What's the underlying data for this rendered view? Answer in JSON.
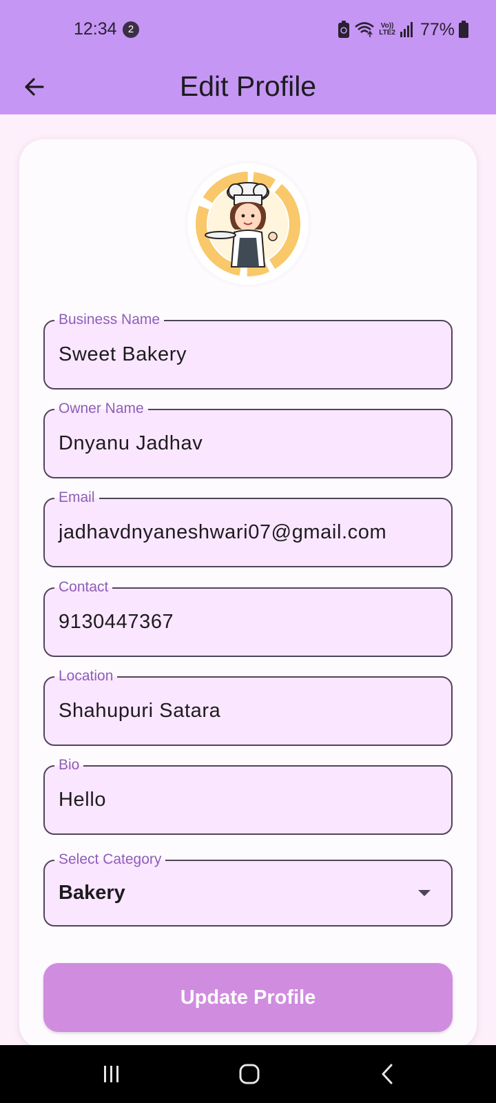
{
  "status_bar": {
    "time": "12:34",
    "notification_count": "2",
    "network_label_top": "Vo))",
    "network_label_bottom": "LTE2",
    "battery_percent": "77%"
  },
  "app_bar": {
    "title": "Edit Profile",
    "back_icon": "arrow-left-icon"
  },
  "avatar": {
    "description_icon": "chef-avatar"
  },
  "form": {
    "fields": [
      {
        "label": "Business Name",
        "value": "Sweet Bakery"
      },
      {
        "label": "Owner Name",
        "value": "Dnyanu Jadhav"
      },
      {
        "label": "Email",
        "value": "jadhavdnyaneshwari07@gmail.com"
      },
      {
        "label": "Contact",
        "value": "9130447367"
      },
      {
        "label": "Location",
        "value": "Shahupuri Satara"
      },
      {
        "label": "Bio",
        "value": "Hello"
      }
    ],
    "category": {
      "label": "Select Category",
      "value": "Bakery"
    },
    "submit_label": "Update Profile"
  },
  "colors": {
    "app_bar": "#c596f3",
    "background": "#fdf0fa",
    "field_fill": "#fae6fe",
    "label": "#8d5eb8",
    "button": "#d08cdf"
  }
}
